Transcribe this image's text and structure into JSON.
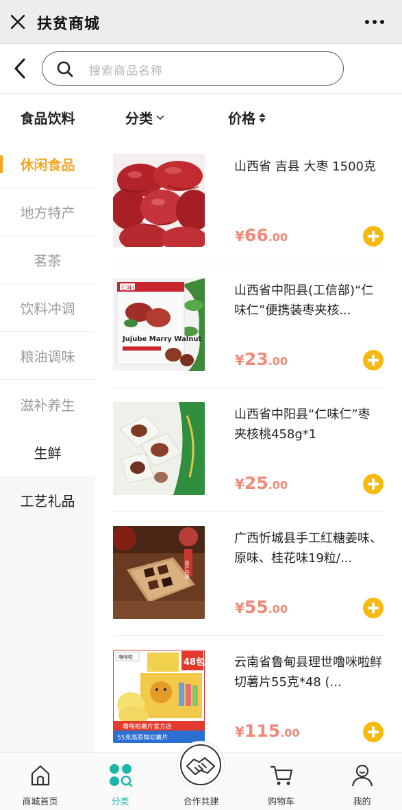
{
  "window": {
    "title": "扶贫商城"
  },
  "search": {
    "placeholder": "搜索商品名称"
  },
  "sidebar": {
    "header": "食品饮料",
    "sub_items": [
      {
        "label": "休闲食品",
        "active": true
      },
      {
        "label": "地方特产",
        "active": false
      },
      {
        "label": "茗茶",
        "active": false
      },
      {
        "label": "饮料冲调",
        "active": false
      },
      {
        "label": "粮油调味",
        "active": false
      },
      {
        "label": "滋补养生",
        "active": false
      }
    ],
    "main_items": [
      {
        "label": "生鲜"
      },
      {
        "label": "工艺礼品"
      }
    ]
  },
  "sort": {
    "category_label": "分类",
    "price_label": "价格"
  },
  "products": [
    {
      "name": "山西省 吉县 大枣 1500克",
      "currency": "¥",
      "price_int": "66",
      "price_dec": ".00"
    },
    {
      "name": "山西省中阳县(工信部)“仁味仁”便携装枣夹核...",
      "currency": "¥",
      "price_int": "23",
      "price_dec": ".00"
    },
    {
      "name": "山西省中阳县“仁味仁”枣夹核桃458g*1",
      "currency": "¥",
      "price_int": "25",
      "price_dec": ".00"
    },
    {
      "name": "广西忻城县手工红糖姜味、原味、桂花味19粒/...",
      "currency": "¥",
      "price_int": "55",
      "price_dec": ".00"
    },
    {
      "name": "云南省鲁甸县理世噜咪啦鲜切薯片55克*48 (...",
      "currency": "¥",
      "price_int": "115",
      "price_dec": ".00"
    }
  ],
  "product_images": {
    "p2_brand": "仁味仁",
    "p2_package": "Jujube Marry Walnut",
    "p4_tag": "自产自销",
    "p5_brand": "噜咪啦",
    "p5_badge": "48包",
    "p5_store": "噜咪啦薯片官方店",
    "p5_caption": "55克高原鲜切薯片"
  },
  "tabbar": {
    "items": [
      {
        "label": "商城首页",
        "icon": "home-icon",
        "active": false
      },
      {
        "label": "分类",
        "icon": "category-icon",
        "active": true
      },
      {
        "label": "合作共建",
        "icon": "handshake-icon",
        "active": false
      },
      {
        "label": "购物车",
        "icon": "cart-icon",
        "active": false
      },
      {
        "label": "我的",
        "icon": "user-icon",
        "active": false
      }
    ]
  },
  "colors": {
    "accent": "#f5a623",
    "price": "#f08a7a",
    "add_button": "#f7b90c",
    "tab_active": "#1bb6a8"
  }
}
